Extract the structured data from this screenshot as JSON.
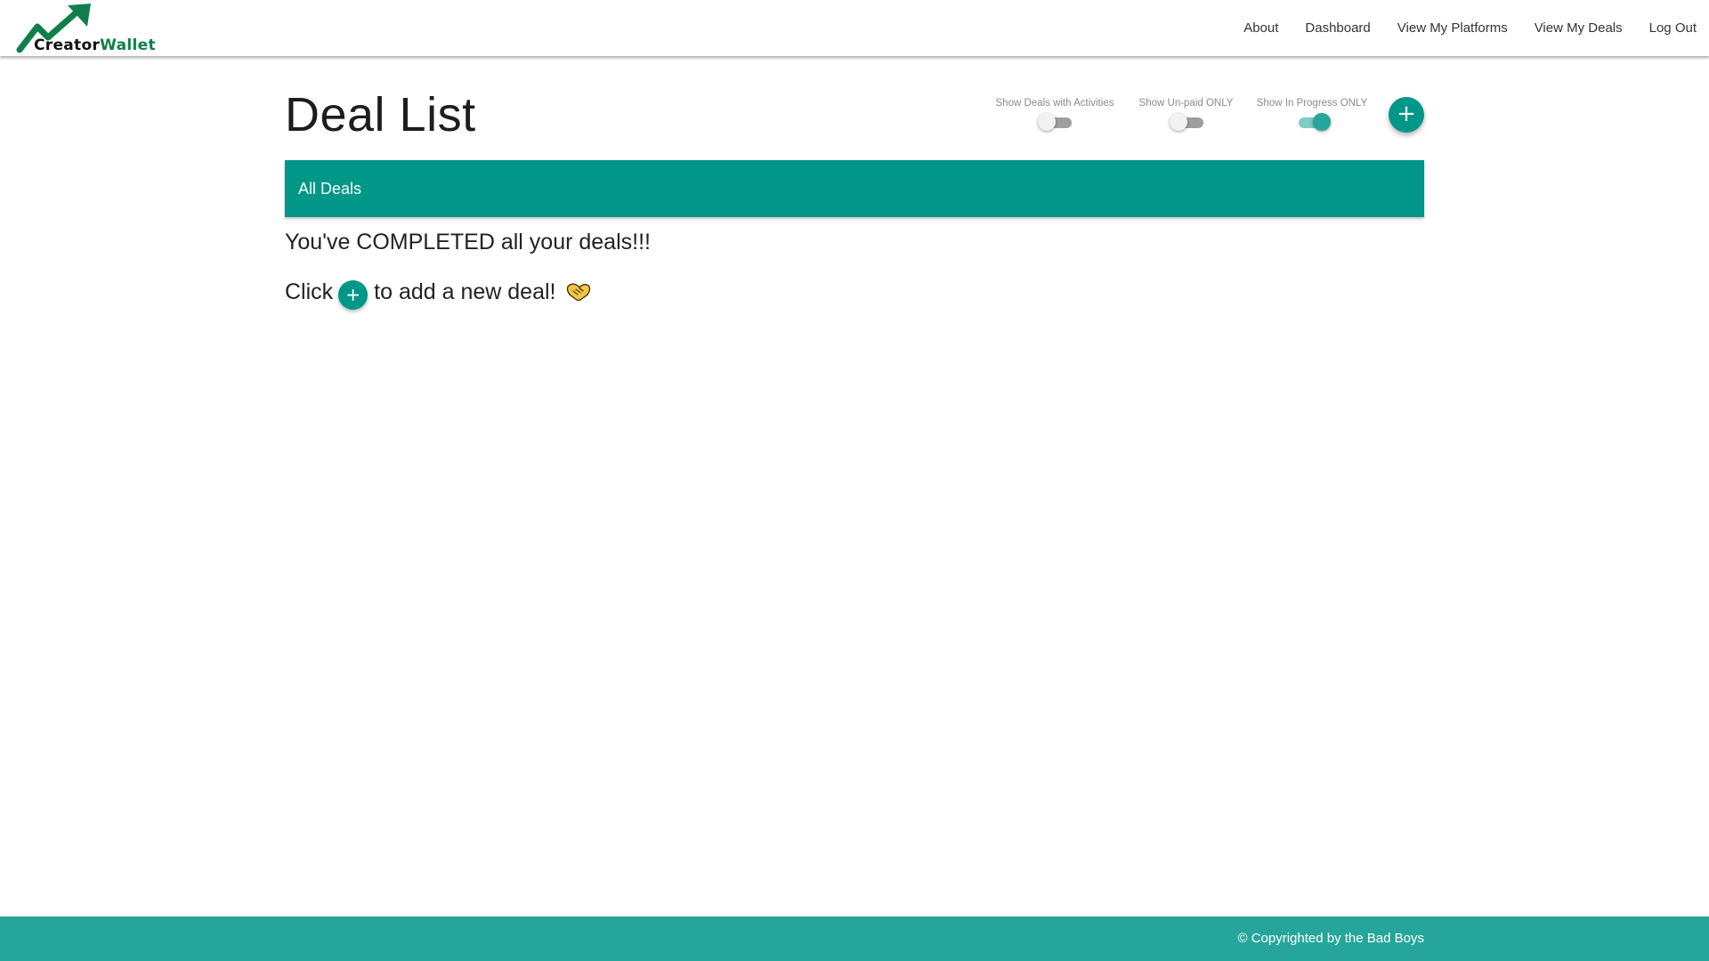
{
  "brand": {
    "name_part1": "Creator",
    "name_part2": "Wallet",
    "accent_color": "#0e7f4a"
  },
  "nav": {
    "links": [
      "About",
      "Dashboard",
      "View My Platforms",
      "View My Deals",
      "Log Out"
    ]
  },
  "page": {
    "title": "Deal List"
  },
  "filters": {
    "activities": {
      "label": "Show Deals with Activities",
      "on": false
    },
    "unpaid": {
      "label": "Show Un-paid ONLY",
      "on": false
    },
    "in_progress": {
      "label": "Show In Progress ONLY",
      "on": true
    }
  },
  "add_button": {
    "icon": "plus-icon",
    "glyph": "+"
  },
  "deals_bar": {
    "label": "All Deals"
  },
  "messages": {
    "completed": "You've COMPLETED all your deals!!!",
    "click": "Click",
    "add_new": "to add a new deal!",
    "emoji_icon": "handshake-icon"
  },
  "footer": {
    "text": "© Copyrighted by the Bad Boys"
  },
  "colors": {
    "primary": "#009688",
    "footer": "#26a69a",
    "switch_on": "#26a69a"
  }
}
